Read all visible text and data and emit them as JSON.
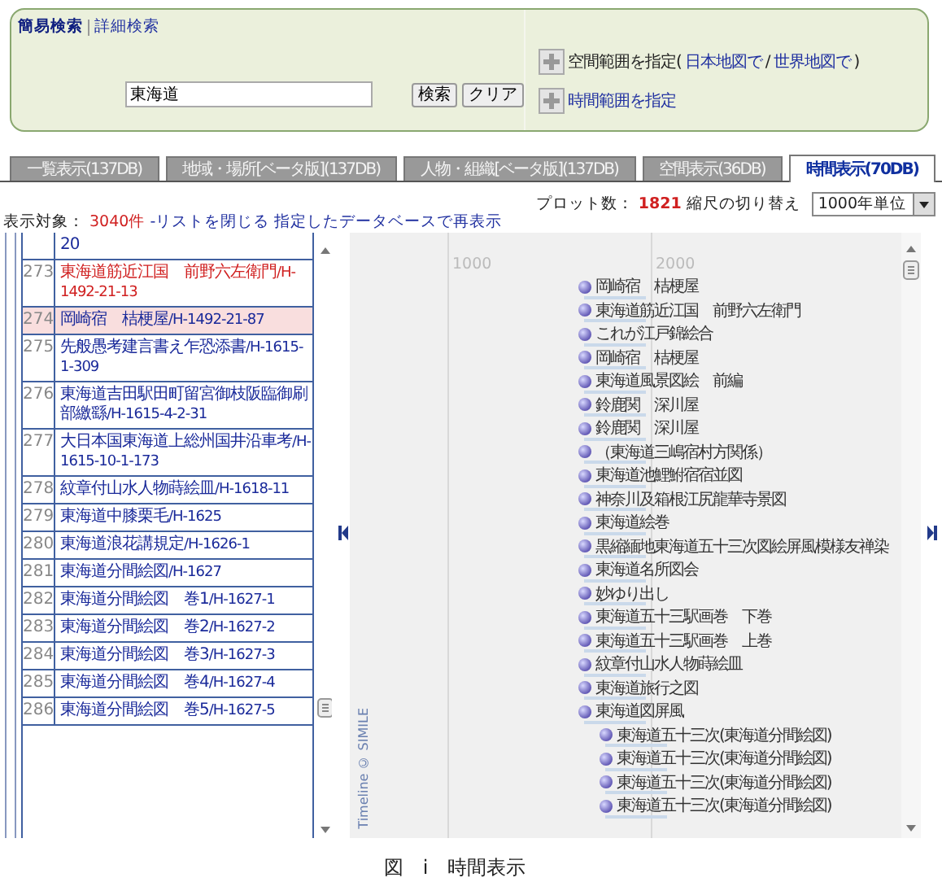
{
  "search_panel": {
    "modes": [
      {
        "label": "簡易検索",
        "selected": true
      },
      {
        "label": "詳細検索",
        "selected": false
      }
    ],
    "query": {
      "value": "東海道"
    },
    "buttons": [
      "検索",
      "クリア"
    ],
    "space_range": {
      "label": "空間範囲を指定(",
      "links": [
        "日本地図で",
        "世界地図で"
      ],
      "separator": "/",
      "close": ")"
    },
    "time_range": {
      "label": "時間範囲を指定"
    }
  },
  "tabs": [
    {
      "label": "一覧表示(137DB)",
      "selected": false
    },
    {
      "label": "地域・場所[ベータ版](137DB)",
      "selected": false
    },
    {
      "label": "人物・組織[ベータ版](137DB)",
      "selected": false
    },
    {
      "label": "空間表示(36DB)",
      "selected": false
    },
    {
      "label": "時間表示(70DB)",
      "selected": true
    }
  ],
  "plot": {
    "label": "プロット数：",
    "count": "1821",
    "scale_label": "縮尺の切り替え",
    "scale": "1000年単位"
  },
  "target": {
    "label": "表示対象：",
    "count": "3040件",
    "links": [
      "-リストを閉じる",
      "指定したデータベースで再表示"
    ]
  },
  "list": {
    "rows": [
      {
        "title": "20",
        "id": "",
        "number": "",
        "selected": false,
        "highlight": false
      },
      {
        "number": "273",
        "title": "東海道筋近江国　前野六左衛門",
        "id": "/H-1492-21-13",
        "selected": false,
        "highlight": true
      },
      {
        "number": "274",
        "title": "岡崎宿　桔梗屋",
        "id": "/H-1492-21-87",
        "selected": true,
        "highlight": false
      },
      {
        "number": "275",
        "title": "先般愚考建言書え乍恐添書",
        "id": "/H-1615-1-309",
        "selected": false,
        "highlight": false
      },
      {
        "number": "276",
        "title": "東海道吉田駅田町留宮御枝阪臨御刷部繳繇",
        "id": "/H-1615-4-2-31",
        "selected": false,
        "highlight": false
      },
      {
        "number": "277",
        "title": "大日本国東海道上総州国井沿車考",
        "id": "/H-1615-10-1-173",
        "selected": false,
        "highlight": false
      },
      {
        "number": "278",
        "title": "紋章付山水人物蒔絵皿",
        "id": "/H-1618-11",
        "selected": false,
        "highlight": false
      },
      {
        "number": "279",
        "title": "東海道中膝栗毛",
        "id": "/H-1625",
        "selected": false,
        "highlight": false
      },
      {
        "number": "280",
        "title": "東海道浪花講規定",
        "id": "/H-1626-1",
        "selected": false,
        "highlight": false
      },
      {
        "number": "281",
        "title": "東海道分間絵図",
        "id": "/H-1627",
        "selected": false,
        "highlight": false
      },
      {
        "number": "282",
        "title": "東海道分間絵図　巻1",
        "id": "/H-1627-1",
        "selected": false,
        "highlight": false
      },
      {
        "number": "283",
        "title": "東海道分間絵図　巻2",
        "id": "/H-1627-2",
        "selected": false,
        "highlight": false
      },
      {
        "number": "284",
        "title": "東海道分間絵図　巻3",
        "id": "/H-1627-3",
        "selected": false,
        "highlight": false
      },
      {
        "number": "285",
        "title": "東海道分間絵図　巻4",
        "id": "/H-1627-4",
        "selected": false,
        "highlight": false
      },
      {
        "number": "286",
        "title": "東海道分間絵図　巻5",
        "id": "/H-1627-5",
        "selected": false,
        "highlight": false
      }
    ]
  },
  "timeline": {
    "ticks": [
      "1000",
      "2000"
    ],
    "credit": "Timeline © SIMILE",
    "events": [
      {
        "label": "岡崎宿　桔梗屋",
        "shifted": false
      },
      {
        "label": "東海道筋近江国　前野六左衛門",
        "shifted": false
      },
      {
        "label": "これが江戸錦絵合",
        "shifted": false
      },
      {
        "label": "岡崎宿　桔梗屋",
        "shifted": false
      },
      {
        "label": "東海道風景図絵　前編",
        "shifted": false
      },
      {
        "label": "鈴鹿関　深川屋",
        "shifted": false
      },
      {
        "label": "鈴鹿関　深川屋",
        "shifted": false
      },
      {
        "label": "（東海道三嶋宿村方関係）",
        "shifted": false
      },
      {
        "label": "東海道池鯉鮒宿宿並図",
        "shifted": false
      },
      {
        "label": "神奈川及箱根江尻龍華寺景図",
        "shifted": false
      },
      {
        "label": "東海道絵巻",
        "shifted": false
      },
      {
        "label": "黒縮緬地東海道五十三次図絵屏風模様友禅染",
        "shifted": false
      },
      {
        "label": "東海道名所図会",
        "shifted": false
      },
      {
        "label": "妙ゆり出し",
        "shifted": false
      },
      {
        "label": "東海道五十三駅画巻　下巻",
        "shifted": false
      },
      {
        "label": "東海道五十三駅画巻　上巻",
        "shifted": false
      },
      {
        "label": "紋章付山水人物蒔絵皿",
        "shifted": false
      },
      {
        "label": "東海道旅行之図",
        "shifted": false
      },
      {
        "label": "東海道図屏風",
        "shifted": false
      },
      {
        "label": "東海道五十三次(東海道分間絵図)",
        "shifted": true
      },
      {
        "label": "東海道五十三次(東海道分間絵図)",
        "shifted": true
      },
      {
        "label": "東海道五十三次(東海道分間絵図)",
        "shifted": true
      },
      {
        "label": "東海道五十三次(東海道分間絵図)",
        "shifted": true
      }
    ]
  },
  "caption": "図　i　時間表示"
}
